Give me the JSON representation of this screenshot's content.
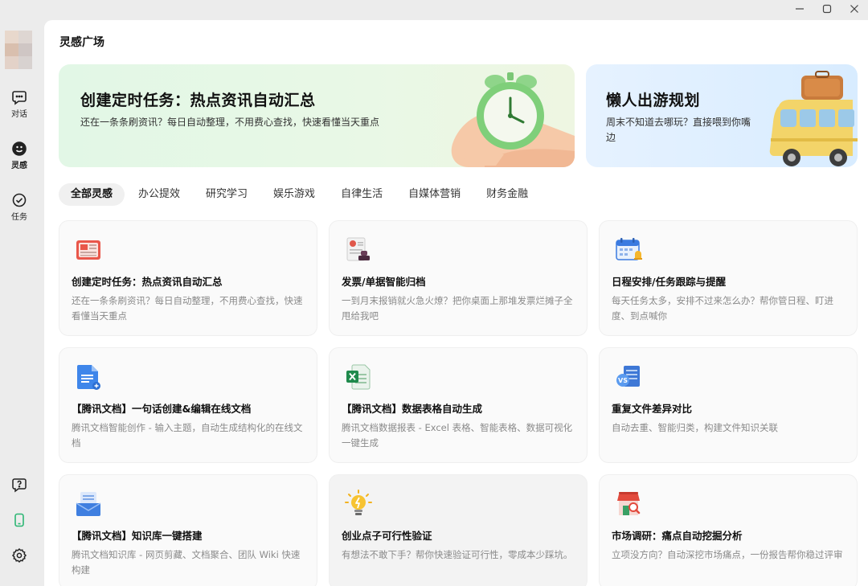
{
  "window": {
    "minimize": "minimize",
    "maximize": "maximize",
    "close": "close"
  },
  "sidebar": {
    "items": [
      {
        "label": "对话",
        "icon": "chat-bubble-icon"
      },
      {
        "label": "灵感",
        "icon": "smiley-icon"
      },
      {
        "label": "任务",
        "icon": "check-circle-icon"
      }
    ],
    "bottom": [
      "help-icon",
      "phone-icon",
      "gear-icon"
    ]
  },
  "page": {
    "title": "灵感广场"
  },
  "banners": [
    {
      "title": "创建定时任务：热点资讯自动汇总",
      "desc": "还在一条条刷资讯？每日自动整理，不用费心查找，快速看懂当天重点"
    },
    {
      "title": "懒人出游规划",
      "desc": "周末不知道去哪玩？直接喂到你嘴边"
    }
  ],
  "tabs": [
    "全部灵感",
    "办公提效",
    "研究学习",
    "娱乐游戏",
    "自律生活",
    "自媒体营销",
    "财务金融"
  ],
  "cards": [
    {
      "title": "创建定时任务：热点资讯自动汇总",
      "desc": "还在一条条刷资讯？每日自动整理，不用费心查找，快速看懂当天重点",
      "icon": "newspaper-icon"
    },
    {
      "title": "发票/单据智能归档",
      "desc": "一到月末报销就火急火燎？把你桌面上那堆发票烂摊子全甩给我吧",
      "icon": "invoice-stamp-icon"
    },
    {
      "title": "日程安排/任务跟踪与提醒",
      "desc": "每天任务太多，安排不过来怎么办？帮你管日程、盯进度、到点喊你",
      "icon": "calendar-bell-icon"
    },
    {
      "title": "【腾讯文档】一句话创建&编辑在线文档",
      "desc": "腾讯文档智能创作 - 输入主题，自动生成结构化的在线文档",
      "icon": "document-icon"
    },
    {
      "title": "【腾讯文档】数据表格自动生成",
      "desc": "腾讯文档数据报表 - Excel 表格、智能表格、数据可视化一键生成",
      "icon": "spreadsheet-icon"
    },
    {
      "title": "重复文件差异对比",
      "desc": "自动去重、智能归类，构建文件知识关联",
      "icon": "file-compare-icon"
    },
    {
      "title": "【腾讯文档】知识库一键搭建",
      "desc": "腾讯文档知识库 - 网页剪藏、文档聚合、团队 Wiki 快速构建",
      "icon": "knowledge-base-icon"
    },
    {
      "title": "创业点子可行性验证",
      "desc": "有想法不敢下手？帮你快速验证可行性，零成本少踩坑。",
      "icon": "lightbulb-icon"
    },
    {
      "title": "市场调研：痛点自动挖掘分析",
      "desc": "立项没方向？自动深挖市场痛点，一份报告帮你稳过评审",
      "icon": "market-research-icon"
    }
  ]
}
